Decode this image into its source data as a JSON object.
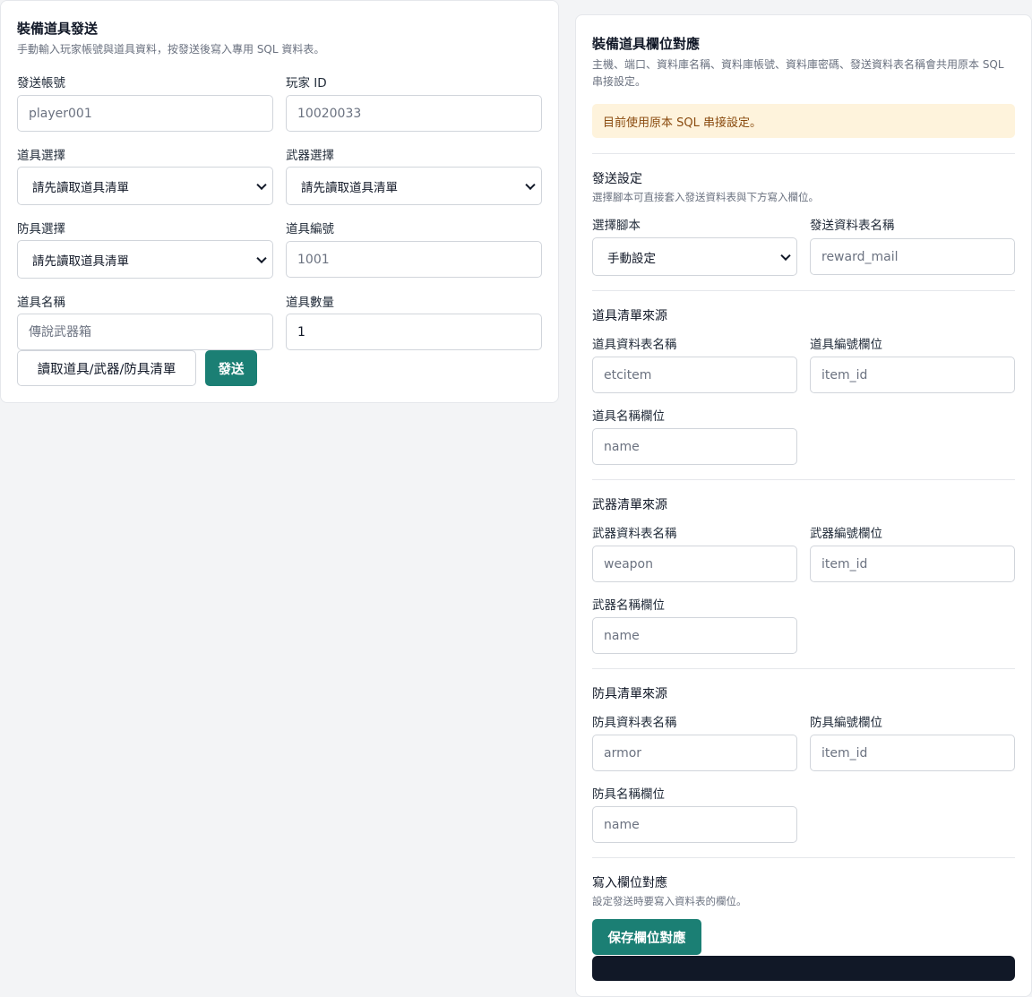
{
  "send_panel": {
    "title": "裝備道具發送",
    "subtitle": "手動輸入玩家帳號與道具資料，按發送後寫入專用 SQL 資料表。",
    "account_label": "發送帳號",
    "account_placeholder": "player001",
    "player_id_label": "玩家 ID",
    "player_id_placeholder": "10020033",
    "item_select_label": "道具選擇",
    "item_select_value": "請先讀取道具清單",
    "weapon_select_label": "武器選擇",
    "weapon_select_value": "請先讀取道具清單",
    "armor_select_label": "防具選擇",
    "armor_select_value": "請先讀取道具清單",
    "item_no_label": "道具編號",
    "item_no_placeholder": "1001",
    "item_name_label": "道具名稱",
    "item_name_placeholder": "傳說武器箱",
    "item_qty_label": "道具數量",
    "item_qty_value": "1",
    "load_button": "讀取道具/武器/防具清單",
    "send_button": "發送"
  },
  "mapping_panel": {
    "title": "裝備道具欄位對應",
    "subtitle": "主機、端口、資料庫名稱、資料庫帳號、資料庫密碼、發送資料表名稱會共用原本 SQL 串接設定。",
    "notice": "目前使用原本 SQL 串接設定。",
    "send_settings": {
      "title": "發送設定",
      "subtitle": "選擇腳本可直接套入發送資料表與下方寫入欄位。",
      "script_label": "選擇腳本",
      "script_value": "手動設定",
      "table_label": "發送資料表名稱",
      "table_placeholder": "reward_mail"
    },
    "item_source": {
      "title": "道具清單來源",
      "table_label": "道具資料表名稱",
      "table_placeholder": "etcitem",
      "id_label": "道具編號欄位",
      "id_placeholder": "item_id",
      "name_label": "道具名稱欄位",
      "name_placeholder": "name"
    },
    "weapon_source": {
      "title": "武器清單來源",
      "table_label": "武器資料表名稱",
      "table_placeholder": "weapon",
      "id_label": "武器編號欄位",
      "id_placeholder": "item_id",
      "name_label": "武器名稱欄位",
      "name_placeholder": "name"
    },
    "armor_source": {
      "title": "防具清單來源",
      "table_label": "防具資料表名稱",
      "table_placeholder": "armor",
      "id_label": "防具編號欄位",
      "id_placeholder": "item_id",
      "name_label": "防具名稱欄位",
      "name_placeholder": "name"
    },
    "write_mapping": {
      "title": "寫入欄位對應",
      "subtitle": "設定發送時要寫入資料表的欄位。",
      "save_button": "保存欄位對應"
    }
  },
  "colors": {
    "primary": "#1b7f74",
    "notice_bg": "#fef3dc",
    "notice_text": "#8a4b0f",
    "log_bar": "#111827"
  }
}
